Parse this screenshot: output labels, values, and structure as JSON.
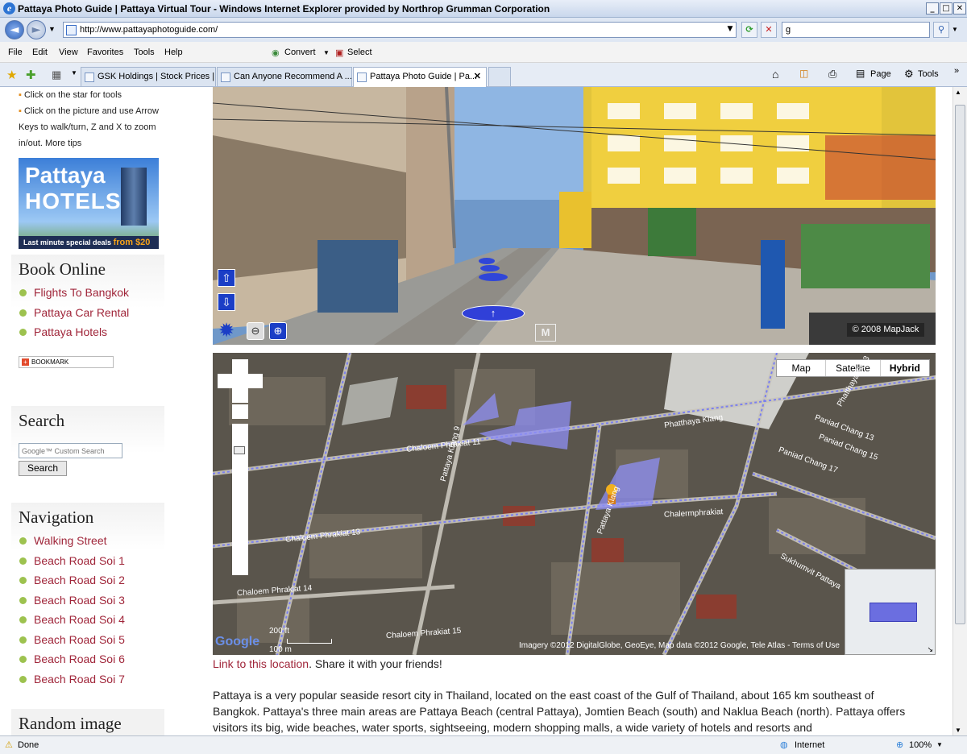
{
  "window": {
    "title": "Pattaya Photo Guide | Pattaya Virtual Tour - Windows Internet Explorer provided by Northrop Grumman Corporation",
    "address": "http://www.pattayaphotoguide.com/",
    "search_value": "g"
  },
  "toolbar": {
    "menu": [
      "File",
      "Edit",
      "View",
      "Favorites",
      "Tools",
      "Help"
    ],
    "convert_label": "Convert",
    "select_label": "Select",
    "page_label": "Page",
    "tools_label": "Tools"
  },
  "tabs": [
    {
      "label": "GSK Holdings | Stock Prices | ..."
    },
    {
      "label": "Can Anyone Recommend A ..."
    },
    {
      "label": "Pattaya Photo Guide | Pa..."
    }
  ],
  "status": {
    "text": "Done",
    "zone": "Internet",
    "zoom": "100%"
  },
  "sidebar": {
    "tips": [
      "Click on the star for tools",
      "Click on the picture and use Arrow Keys to walk/turn, Z and X to zoom in/out. More tips"
    ],
    "banner": {
      "title1": "Pattaya",
      "title2": "HOTELS",
      "tagline": "Last minute special deals",
      "price": "from $20"
    },
    "book_online": {
      "heading": "Book Online",
      "items": [
        "Flights To Bangkok",
        "Pattaya Car Rental",
        "Pattaya Hotels"
      ]
    },
    "bookmark_label": "BOOKMARK",
    "search": {
      "heading": "Search",
      "placeholder": "Google™ Custom Search",
      "button": "Search"
    },
    "navigation": {
      "heading": "Navigation",
      "items": [
        "Walking Street",
        "Beach Road Soi 1",
        "Beach Road Soi 2",
        "Beach Road Soi 3",
        "Beach Road Soi 4",
        "Beach Road Soi 5",
        "Beach Road Soi 6",
        "Beach Road Soi 7"
      ]
    },
    "random_heading": "Random image"
  },
  "pano": {
    "copyright": "© 2008 MapJack",
    "sign_line": "M"
  },
  "map": {
    "type_buttons": [
      "Map",
      "Satellite",
      "Hybrid"
    ],
    "selected_type": "Hybrid",
    "scale_ft": "200 ft",
    "scale_m": "100 m",
    "attribution": "Imagery ©2012 DigitalGlobe, GeoEye, Map data ©2012 Google, Tele Atlas - Terms of Use",
    "google_logo": "Google",
    "street_labels": [
      "Pattaya Klang 9",
      "Phatthaya Klang",
      "Pattaya Klang",
      "Chaloem Phrakiat 11",
      "Chaloem Phrakiat 13",
      "Chaloem Phrakiat 14",
      "Chaloem Phrakiat 15",
      "Chalermphrakiat",
      "Paniad Chang 13",
      "Paniad Chang 15",
      "Paniad Chang 17",
      "Sukhumvit Pattaya",
      "Phatthaya Sai 3"
    ]
  },
  "content": {
    "share_link": "Link to this location",
    "share_text": ". Share it with your friends!",
    "paragraph": "Pattaya is a very popular seaside resort city in Thailand, located on the east coast of the Gulf of Thailand, about 165 km southeast of Bangkok. Pattaya's three main areas are Pattaya Beach (central Pattaya), Jomtien Beach (south) and Naklua Beach (north). Pattaya offers visitors its big, wide beaches, water sports, sightseeing, modern shopping malls, a wide variety of hotels and resorts and"
  }
}
